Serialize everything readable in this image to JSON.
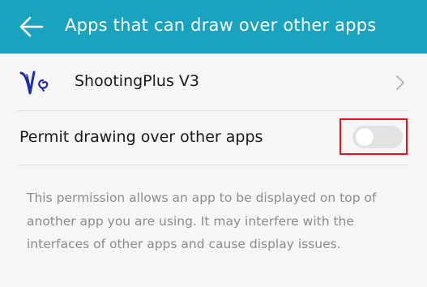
{
  "colors": {
    "accent": "#1aa3be",
    "highlight": "#e0141d"
  },
  "header": {
    "back_icon": "back-arrow-icon",
    "title": "Apps that can draw over other apps"
  },
  "app": {
    "icon": "shootingplus-logo-icon",
    "name": "ShootingPlus V3",
    "chevron_icon": "chevron-right-icon"
  },
  "permission": {
    "label": "Permit drawing over other apps",
    "enabled": false
  },
  "description": "This permission allows an app to be displayed on top of another app you are using. It may interfere with the interfaces of other apps and cause display issues."
}
